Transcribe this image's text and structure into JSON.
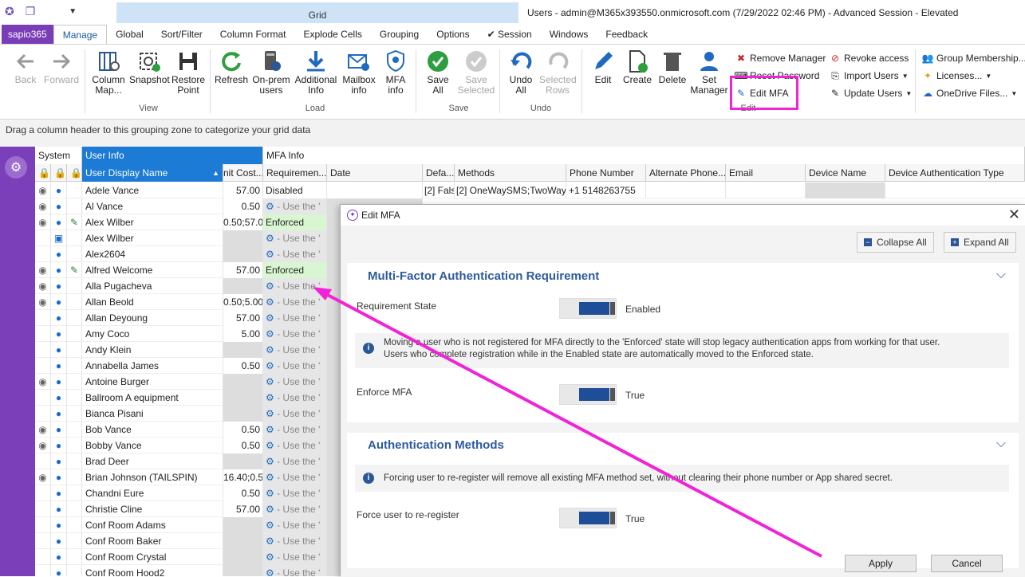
{
  "titlebar": {
    "context_tab": "Grid",
    "window_title": "Users - admin@M365x393550.onmicrosoft.com (7/29/2022 02:46 PM) - Advanced Session - Elevated"
  },
  "tabs": [
    "sapio365",
    "Manage",
    "Global",
    "Sort/Filter",
    "Column Format",
    "Explode Cells",
    "Grouping",
    "Options",
    "✔ Session",
    "Windows",
    "Feedback"
  ],
  "ribbon": {
    "back": "Back",
    "forward": "Forward",
    "column_map": "Column Map...",
    "snapshot": "Snapshot",
    "restore_point": "Restore Point",
    "view_group": "View",
    "refresh": "Refresh",
    "onprem": "On-prem users",
    "additional_info": "Additional Info",
    "mailbox_info": "Mailbox info",
    "mfa_info": "MFA info",
    "load_group": "Load",
    "save_all": "Save All",
    "save_selected": "Save Selected",
    "save_group": "Save",
    "undo_all": "Undo All",
    "selected_rows": "Selected Rows",
    "undo_group": "Undo",
    "edit": "Edit",
    "create": "Create",
    "delete": "Delete",
    "set_manager": "Set Manager",
    "remove_manager": "Remove Manager",
    "reset_password": "Reset Password",
    "edit_mfa": "Edit MFA",
    "edit_group": "Edit",
    "revoke_access": "Revoke access",
    "import_users": "Import Users",
    "update_users": "Update Users",
    "group_membership": "Group Membership...",
    "licenses": "Licenses...",
    "onedrive_files": "OneDrive Files..."
  },
  "grouping_zone": "Drag a column header to this grouping zone to categorize your grid data",
  "grid": {
    "bands": {
      "system": "System",
      "user_info": "User Info",
      "mfa_info": "MFA Info"
    },
    "headers": {
      "display_name": "User Display Name",
      "cost": "nit Cost...",
      "requirement": "Requiremen...",
      "date": "Date",
      "default": "Defa...",
      "methods": "Methods",
      "phone": "Phone Number",
      "alt_phone": "Alternate Phone...",
      "email": "Email",
      "device": "Device Name",
      "device_auth": "Device Authentication Type"
    },
    "first_row_extra": {
      "default": "[2] Fals",
      "methods": "[2] OneWaySMS;TwoWay\\",
      "phone": "+1 5148263755"
    },
    "use_text": "- Use the '",
    "rows": [
      {
        "name": "Adele Vance",
        "cost": "57.00",
        "req": "Disabled",
        "flag": "on",
        "pencil": false,
        "icon": "user"
      },
      {
        "name": "Al Vance",
        "cost": "0.50",
        "req": "",
        "flag": "on",
        "pencil": false,
        "icon": "user"
      },
      {
        "name": "Alex Wilber",
        "cost": "0.50;57.0",
        "req": "Enforced",
        "flag": "on",
        "pencil": true,
        "icon": "user"
      },
      {
        "name": "Alex Wilber",
        "cost": "",
        "req": "",
        "flag": "",
        "pencil": false,
        "icon": "badge"
      },
      {
        "name": "Alex2604",
        "cost": "",
        "req": "",
        "flag": "",
        "pencil": false,
        "icon": "user"
      },
      {
        "name": "Alfred Welcome",
        "cost": "57.00",
        "req": "Enforced",
        "flag": "on",
        "pencil": true,
        "icon": "user"
      },
      {
        "name": "Alla Pugacheva",
        "cost": "",
        "req": "",
        "flag": "on",
        "pencil": false,
        "icon": "user"
      },
      {
        "name": "Allan Beold",
        "cost": "0.50;5.00",
        "req": "",
        "flag": "on",
        "pencil": false,
        "icon": "user"
      },
      {
        "name": "Allan Deyoung",
        "cost": "57.00",
        "req": "",
        "flag": "",
        "pencil": false,
        "icon": "user"
      },
      {
        "name": "Amy Coco",
        "cost": "5.00",
        "req": "",
        "flag": "",
        "pencil": false,
        "icon": "user"
      },
      {
        "name": "Andy Klein",
        "cost": "",
        "req": "",
        "flag": "",
        "pencil": false,
        "icon": "user"
      },
      {
        "name": "Annabella James",
        "cost": "0.50",
        "req": "",
        "flag": "",
        "pencil": false,
        "icon": "user"
      },
      {
        "name": "Antoine Burger",
        "cost": "",
        "req": "",
        "flag": "on",
        "pencil": false,
        "icon": "user"
      },
      {
        "name": "Ballroom A equipment",
        "cost": "",
        "req": "",
        "flag": "",
        "pencil": false,
        "icon": "user"
      },
      {
        "name": "Bianca Pisani",
        "cost": "",
        "req": "",
        "flag": "",
        "pencil": false,
        "icon": "user"
      },
      {
        "name": "Bob Vance",
        "cost": "0.50",
        "req": "",
        "flag": "on",
        "pencil": false,
        "icon": "user"
      },
      {
        "name": "Bobby Vance",
        "cost": "0.50",
        "req": "",
        "flag": "on",
        "pencil": false,
        "icon": "user"
      },
      {
        "name": "Brad Deer",
        "cost": "",
        "req": "",
        "flag": "",
        "pencil": false,
        "icon": "user"
      },
      {
        "name": "Brian Johnson (TAILSPIN)",
        "cost": "16.40;0.5",
        "req": "",
        "flag": "on",
        "pencil": false,
        "icon": "user"
      },
      {
        "name": "Chandni Eure",
        "cost": "0.50",
        "req": "",
        "flag": "",
        "pencil": false,
        "icon": "user"
      },
      {
        "name": "Christie Cline",
        "cost": "57.00",
        "req": "",
        "flag": "",
        "pencil": false,
        "icon": "user"
      },
      {
        "name": "Conf Room Adams",
        "cost": "",
        "req": "",
        "flag": "",
        "pencil": false,
        "icon": "user"
      },
      {
        "name": "Conf Room Baker",
        "cost": "",
        "req": "",
        "flag": "",
        "pencil": false,
        "icon": "user"
      },
      {
        "name": "Conf Room Crystal",
        "cost": "",
        "req": "",
        "flag": "",
        "pencil": false,
        "icon": "user"
      },
      {
        "name": "Conf Room Hood2",
        "cost": "",
        "req": "",
        "flag": "",
        "pencil": false,
        "icon": "user"
      }
    ]
  },
  "dialog": {
    "title": "Edit MFA",
    "collapse_all": "Collapse All",
    "expand_all": "Expand All",
    "section1": "Multi-Factor Authentication Requirement",
    "requirement_state_label": "Requirement State",
    "requirement_state_value": "Enabled",
    "info1_line1": "Moving a user who is not registered for MFA directly to the 'Enforced' state will stop legacy authentication apps from working for that user.",
    "info1_line2": "Users who complete registration while in the Enabled state are automatically moved to the Enforced state.",
    "enforce_label": "Enforce MFA",
    "enforce_value": "True",
    "section2": "Authentication Methods",
    "info2": "Forcing user to re-register will remove all existing MFA method set, without clearing their phone number or App shared secret.",
    "reregister_label": "Force user to re-register",
    "reregister_value": "True",
    "apply": "Apply",
    "cancel": "Cancel"
  }
}
